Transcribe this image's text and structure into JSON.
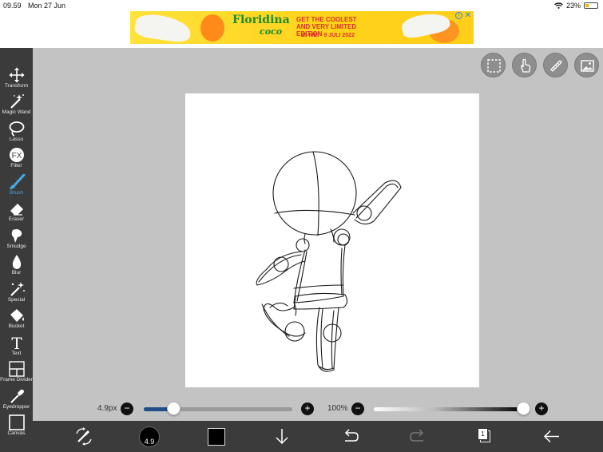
{
  "status": {
    "time": "09.59",
    "date": "Mon 27 Jun",
    "battery": "23%"
  },
  "ad": {
    "brand": "Floridina",
    "brand_sub": "coco",
    "tagline": "GET THE COOLEST AND VERY LIMITED EDITION",
    "dates": "25 MEI - 9 JULI 2022",
    "info_icon": "info-icon",
    "close_icon": "close-icon"
  },
  "tools": [
    {
      "label": "Transform",
      "icon": "move-arrows-icon"
    },
    {
      "label": "Magic Wand",
      "icon": "magic-wand-icon"
    },
    {
      "label": "Lasso",
      "icon": "lasso-icon"
    },
    {
      "label": "Filter",
      "icon": "fx-icon",
      "glyph": "FX"
    },
    {
      "label": "Brush",
      "icon": "brush-icon",
      "active": true
    },
    {
      "label": "Eraser",
      "icon": "eraser-icon"
    },
    {
      "label": "Smudge",
      "icon": "smudge-icon"
    },
    {
      "label": "Blur",
      "icon": "blur-drop-icon"
    },
    {
      "label": "Special",
      "icon": "special-sparkle-icon"
    },
    {
      "label": "Bucket",
      "icon": "bucket-icon"
    },
    {
      "label": "Text",
      "icon": "text-icon",
      "glyph": "T"
    },
    {
      "label": "Frame Divider",
      "icon": "frame-divider-icon"
    },
    {
      "label": "Eyedropper",
      "icon": "eyedropper-icon"
    },
    {
      "label": "Canvas",
      "icon": "canvas-icon"
    }
  ],
  "brush": {
    "size_label": "4.9px",
    "size_level": 0.2,
    "opacity_label": "100%",
    "opacity_level": 1.0,
    "minus": "−",
    "plus": "+"
  },
  "bottom": {
    "brush_size_badge": "4.9",
    "primary_color": "#000000",
    "layer_count": "1"
  },
  "colors": {
    "accent": "#4aa7ea",
    "toolbar_bg": "#3b3b3b",
    "workspace_bg": "#c3c3c3",
    "slider_fill": "#1f4e8a"
  }
}
